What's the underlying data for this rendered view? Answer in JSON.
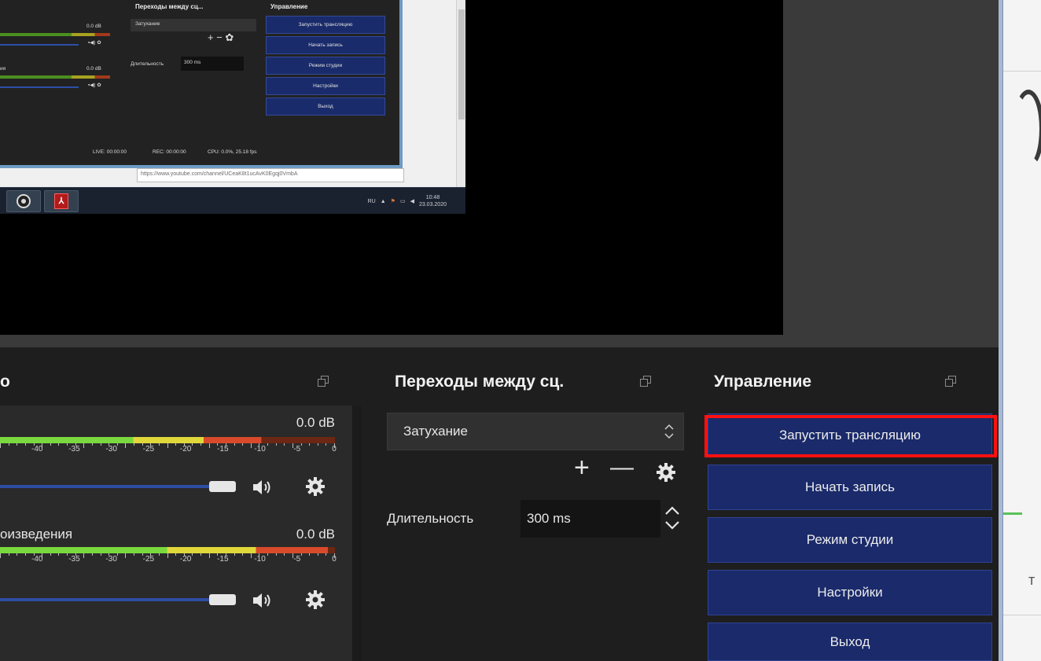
{
  "nested_screen": {
    "transitions_title": "Переходы между сц...",
    "controls_title": "Управление",
    "transition_value": "Затухание",
    "duration_label": "Длительность",
    "duration_value": "300 ms",
    "db_1": "0.0 dB",
    "db_2": "0.0 dB",
    "channel_2_partial": "ия",
    "buttons": [
      "Запустить трансляцию",
      "Начать запись",
      "Режим студии",
      "Настройки",
      "Выход"
    ],
    "status_live": "LIVE: 00:00:00",
    "status_rec": "REC: 00:00:00",
    "status_cpu": "CPU: 0.0%, 25.18 fps",
    "url": "https://www.youtube.com/channel/UCeaK8t1ucAvK0Egqj0VmbA",
    "tray_lang": "RU",
    "tray_time": "10:48",
    "tray_date": "23.03.2020"
  },
  "audio_mixer": {
    "title": "о",
    "channels": [
      {
        "name": "",
        "db": "0.0 dB",
        "level": 0.78
      },
      {
        "name": "оизведения",
        "db": "0.0 dB",
        "level": 0.98
      }
    ],
    "tick_labels": [
      "-40",
      "-35",
      "-30",
      "-25",
      "-20",
      "-15",
      "-10",
      "-5",
      "0"
    ]
  },
  "transitions": {
    "title": "Переходы между сц.",
    "selected": "Затухание",
    "add_symbol": "+",
    "remove_symbol": "—",
    "duration_label": "Длительность",
    "duration_value": "300 ms"
  },
  "controls": {
    "title": "Управление",
    "start_stream": "Запустить трансляцию",
    "start_recording": "Начать запись",
    "studio_mode": "Режим студии",
    "settings": "Настройки",
    "exit": "Выход"
  },
  "colors": {
    "button_bg": "#1a2a6a",
    "highlight": "#ff1111",
    "dock_bg": "#1e1e1e"
  }
}
